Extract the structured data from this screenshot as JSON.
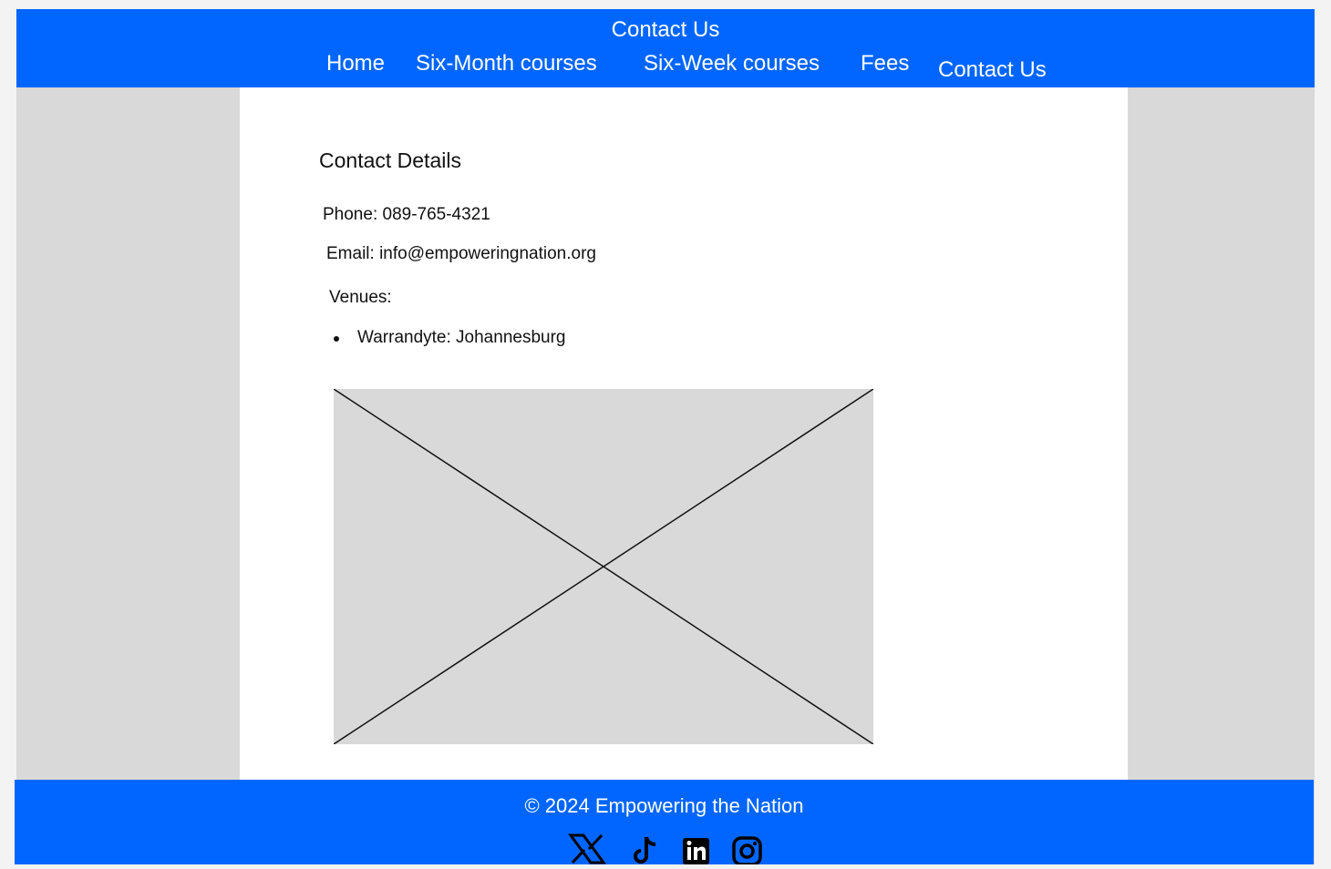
{
  "header": {
    "title": "Contact Us",
    "nav": [
      {
        "label": "Home"
      },
      {
        "label": "Six-Month courses"
      },
      {
        "label": "Six-Week courses"
      },
      {
        "label": "Fees"
      },
      {
        "label": "Contact Us"
      }
    ]
  },
  "main": {
    "heading": "Contact Details",
    "phone": "Phone: 089-765-4321",
    "email": "Email: info@empoweringnation.org",
    "venues_label": "Venues:",
    "venues": [
      "Warrandyte: Johannesburg"
    ],
    "image_icon": "image-placeholder-icon"
  },
  "footer": {
    "copyright": "© 2024 Empowering the Nation",
    "social_icons": [
      "x-icon",
      "tiktok-icon",
      "linkedin-icon",
      "instagram-icon"
    ]
  },
  "colors": {
    "brand_blue": "#0066ff",
    "background_gray": "#d9d9d9",
    "content_white": "#ffffff"
  }
}
